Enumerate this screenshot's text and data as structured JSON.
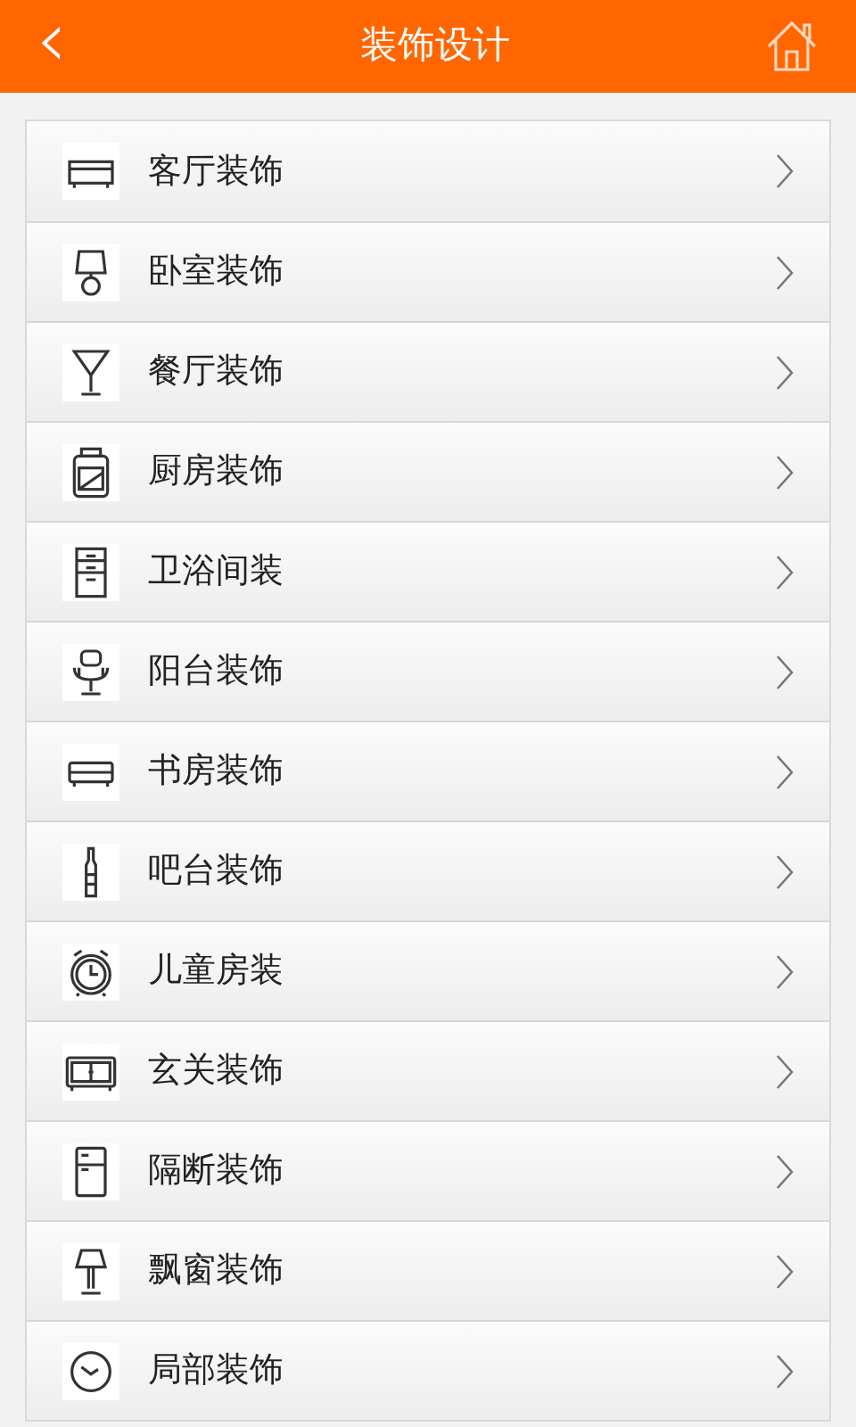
{
  "header": {
    "back": "‹",
    "title": "装饰设计"
  },
  "items": [
    {
      "label": "客厅装饰",
      "kind": "sofa"
    },
    {
      "label": "卧室装饰",
      "kind": "lamp"
    },
    {
      "label": "餐厅装饰",
      "kind": "glass"
    },
    {
      "label": "厨房装饰",
      "kind": "jar"
    },
    {
      "label": "卫浴间装",
      "kind": "cabinet"
    },
    {
      "label": "阳台装饰",
      "kind": "chair"
    },
    {
      "label": "书房装饰",
      "kind": "bench"
    },
    {
      "label": "吧台装饰",
      "kind": "bottle"
    },
    {
      "label": "儿童房装",
      "kind": "alarm"
    },
    {
      "label": "玄关装饰",
      "kind": "sideboard"
    },
    {
      "label": "隔断装饰",
      "kind": "fridge"
    },
    {
      "label": "飘窗装饰",
      "kind": "floorlamp"
    },
    {
      "label": "局部装饰",
      "kind": "clock"
    }
  ]
}
